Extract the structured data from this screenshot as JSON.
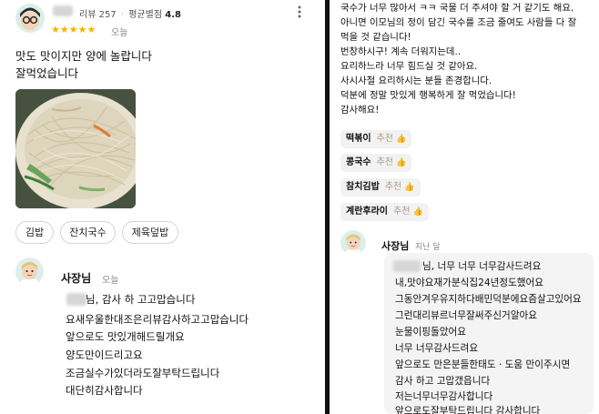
{
  "left": {
    "reviewer": {
      "review_count": "리뷰 257",
      "separator": "·",
      "avg_label": "평균별점",
      "avg_value": "4.8",
      "stars": "★★★★★",
      "date": "오늘"
    },
    "review_lines": [
      "맛도 맛이지만 양에 놀랍니다",
      "잘먹었습니다"
    ],
    "tags": [
      "김밥",
      "잔치국수",
      "제육덮밥"
    ],
    "owner": {
      "name": "사장님",
      "date": "오늘",
      "lines": [
        "님, 감사 하 고고맙습니다",
        "요새우울한대조은리뷰감사하고고맙습니다",
        "앞으로도 맛있개해드릴개요",
        "양도만이드리고요",
        "조금실수가있더라도잘부탁드립니다",
        "대단히감사합니다"
      ]
    }
  },
  "right": {
    "review_lines": [
      "국수가 너무 많아서 ㅋㅋ 국물 더 주셔야 할 거 같기도 해요.",
      "아니면 이모님의 정이 담긴 국수를 조금 줄여도 사람들 다 잘",
      "먹을 것 같습니다!",
      "번창하시구! 계속 더워지는데..",
      "요리하느라 너무 힘드실 것 같아요.",
      "사시사철 요리하시는 분들 존경합니다.",
      "덕분에 정말 맛있게 행복하게 잘 먹었습니다!",
      "감사해요!"
    ],
    "menu_recs": [
      {
        "name": "떡볶이",
        "rec": "추천"
      },
      {
        "name": "콩국수",
        "rec": "추천"
      },
      {
        "name": "참치김밥",
        "rec": "추천"
      },
      {
        "name": "계란후라이",
        "rec": "추천"
      }
    ],
    "owner": {
      "name": "사장님",
      "date": "지난 달",
      "lines": [
        "님, 너무 너무 너무감사드려요",
        "내,맛야요재가분식집24년정도했어요",
        "그동안겨우유지하다배민덕분에요즘살고있어요",
        "그런대리뷰르너무잘써주신거알아요",
        "눈물이핑돌았어요",
        "너무 너무감사드려요",
        "앞으로도 만은분들한태도 · 도움 만이주시면",
        "감사 하고 고맙갰읍니다",
        "저는너무너무감사합니다",
        "앞으로도잘부탁드립니다 감사합니다"
      ]
    }
  },
  "colors": {
    "star": "#f5b301",
    "divider": "#111111",
    "reply_bg": "#f4f4f4"
  },
  "icons": [
    "reviewer-avatar-icon",
    "owner-avatar-icon",
    "kebab-menu-icon",
    "thumb-up-icon"
  ]
}
